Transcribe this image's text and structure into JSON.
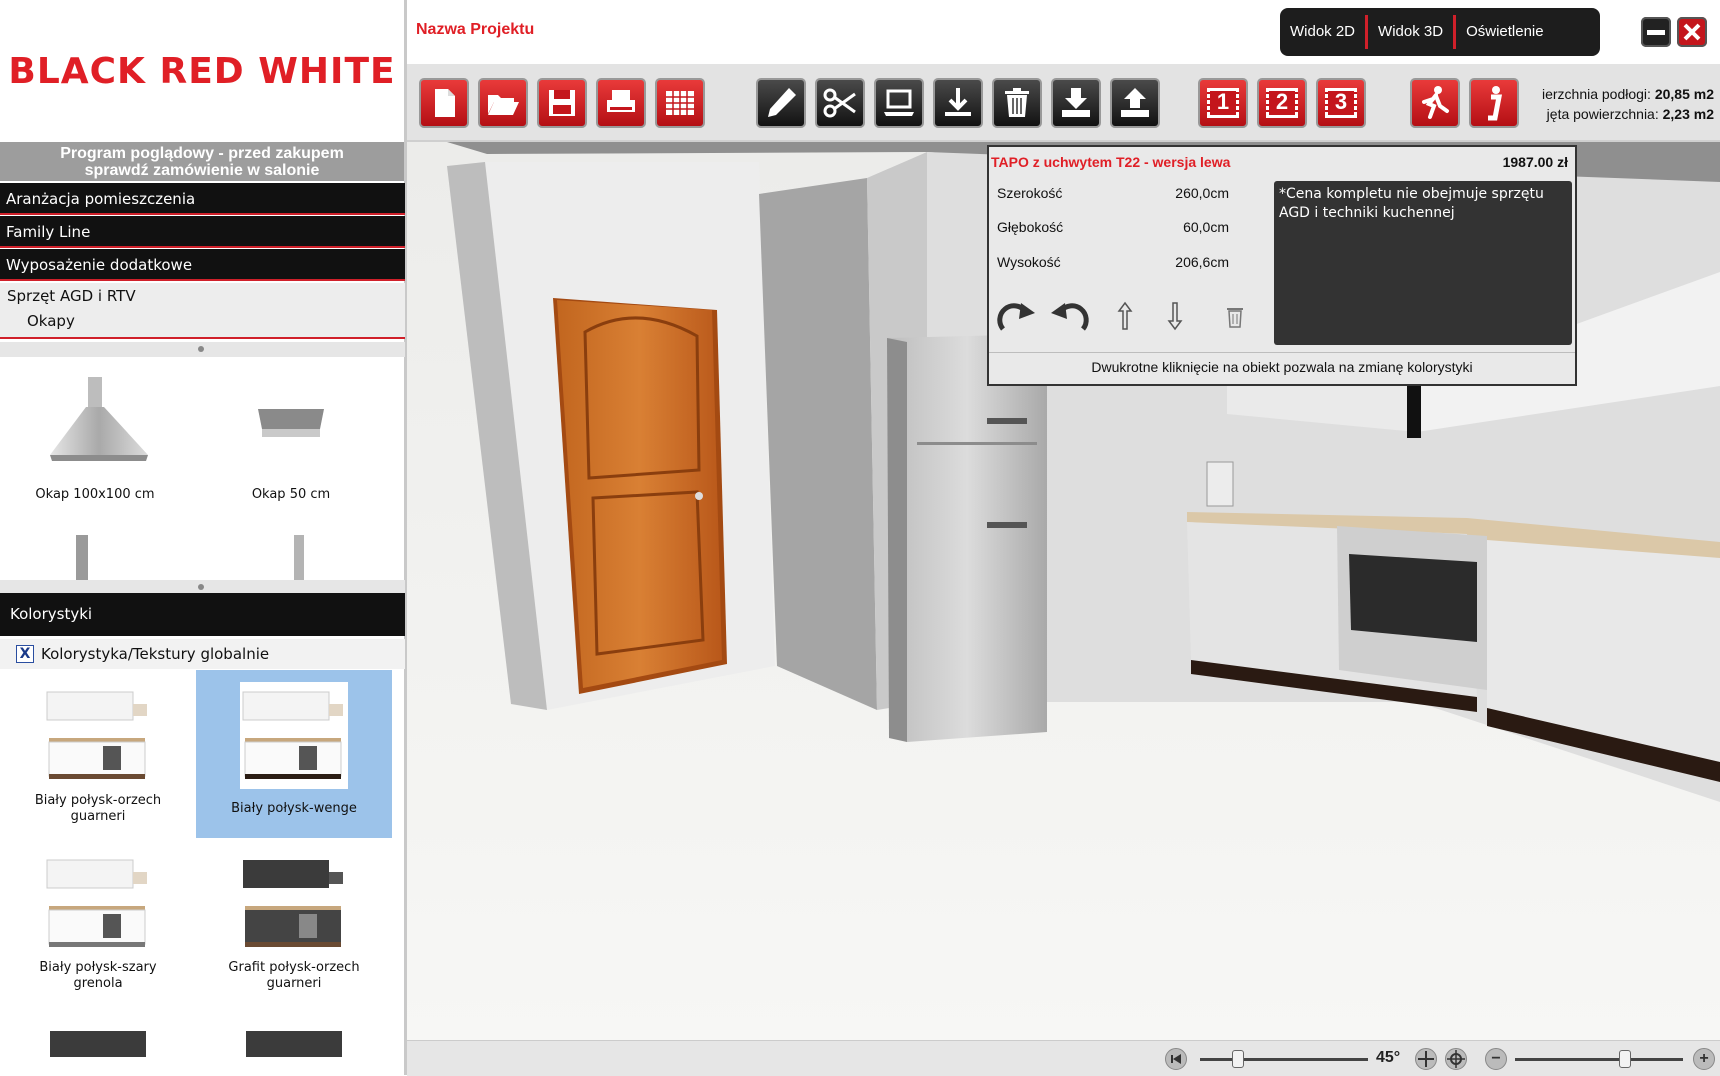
{
  "brand": {
    "logo_text": "BLACK RED WHITE"
  },
  "sidebar": {
    "notice_line1": "Program poglądowy - przed zakupem",
    "notice_line2": "sprawdź zamówienie w salonie",
    "menu": [
      {
        "label": "Aranżacja pomieszczenia"
      },
      {
        "label": "Family Line"
      },
      {
        "label": "Wyposażenie dodatkowe"
      }
    ],
    "submenu": {
      "parent": "Sprzęt AGD i RTV",
      "child": "Okapy"
    },
    "products": [
      {
        "label": "Okap 100x100 cm"
      },
      {
        "label": "Okap 50 cm"
      }
    ],
    "kolorystyki_label": "Kolorystyki",
    "global_textures_label": "Kolorystyka/Tekstury globalnie",
    "global_textures_mark": "X",
    "swatches": [
      {
        "line1": "Biały połysk-orzech",
        "line2": "guarneri",
        "selected": false
      },
      {
        "line1": "Biały połysk-wenge",
        "line2": "",
        "selected": true
      },
      {
        "line1": "Biały połysk-szary",
        "line2": "grenola",
        "selected": false
      },
      {
        "line1": "Grafit połysk-orzech",
        "line2": "guarneri",
        "selected": false
      }
    ]
  },
  "header": {
    "project_name": "Nazwa Projektu",
    "view_buttons": [
      "Widok 2D",
      "Widok 3D",
      "Oświetlenie"
    ],
    "area": {
      "floor_label": "ierzchnia podłogi:",
      "floor_value": "20,85 m2",
      "used_label": "jęta powierzchnia:",
      "used_value": "2,23 m2"
    }
  },
  "toolbar": {
    "icons": [
      "new-file-icon",
      "open-folder-icon",
      "save-icon",
      "print-icon",
      "table-icon",
      "pencil-icon",
      "scissors-icon",
      "monitor-icon",
      "download-icon",
      "trash-icon",
      "import-icon",
      "export-icon",
      "view-1-icon",
      "view-2-icon",
      "view-3-icon",
      "walk-icon",
      "info-icon"
    ],
    "view_numbers": [
      "1",
      "2",
      "3"
    ],
    "accent": "#e01f26"
  },
  "popup": {
    "title": "TAPO z uchwytem T22 - wersja lewa",
    "price": "1987.00  zł",
    "dimensions": [
      {
        "label": "Szerokość",
        "value": "260,0cm"
      },
      {
        "label": "Głębokość",
        "value": "60,0cm"
      },
      {
        "label": "Wysokość",
        "value": "206,6cm"
      }
    ],
    "note": "*Cena kompletu nie obejmuje sprzętu AGD i techniki kuchennej",
    "hint": "Dwukrotne kliknięcie na obiekt pozwala na zmianę kolorystyki"
  },
  "bottom": {
    "angle": "45°",
    "zoom_minus": "−",
    "zoom_plus": "+"
  },
  "colors": {
    "brand_red": "#e01f26",
    "menu_black": "#111111",
    "selection_blue": "#9cc3ea",
    "scroll_orange": "#f5a800"
  }
}
